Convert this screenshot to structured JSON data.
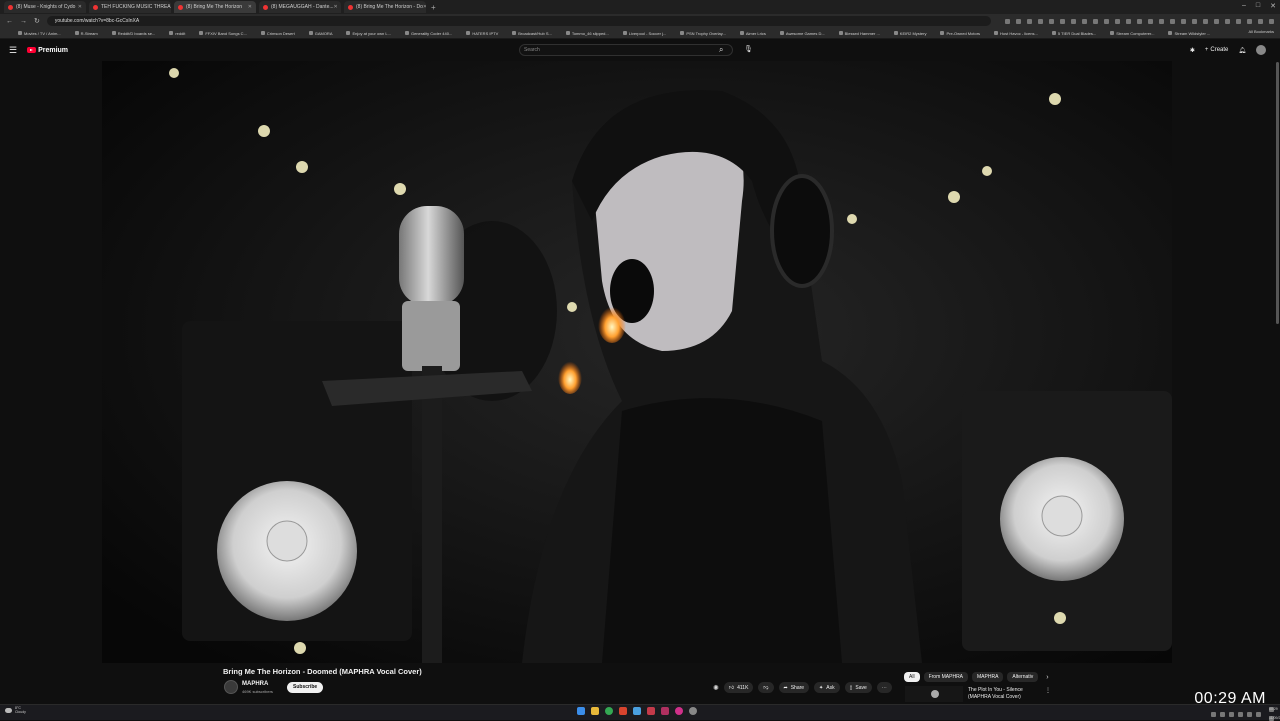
{
  "browser": {
    "tabs": [
      {
        "label": "(8) Muse - Knights of Cydo",
        "active": false
      },
      {
        "label": "TEH FUCKING MUSIC THREAD",
        "active": false
      },
      {
        "label": "(8) Bring Me The Horizon",
        "active": true
      },
      {
        "label": "(8) MEGAUGGAH - Dante...",
        "active": false
      },
      {
        "label": "(8) Bring Me The Horizon - Do",
        "active": false
      }
    ],
    "new_tab": "+",
    "url": "youtube.com/watch?v=8bc-GcCsInXA",
    "bookmarks": [
      "Movies / TV / Anim...",
      "R-Stream",
      "Reddit/D boards se...",
      "reddit",
      "FFXIV Band Songs C...",
      "Crimson Desert",
      "GAMORA",
      "Enjoy at your own L...",
      "Generality Coder 440...",
      "HATERS IPTV",
      "Broadcast/Hub S...",
      "Tommo_46 slipped...",
      "Liverpool - Soccer j...",
      "PSN Trophy Overlay...",
      "Aimer Lrics",
      "Awesome Games D...",
      "Blessed Hammer ...",
      "KEIR2 Mystery",
      "Pre-Owned Motors",
      "Host Havoc - licens...",
      "5 TIER Dual Blades...",
      "Stream Computerer...",
      "Stream Wildstyler ..."
    ],
    "all_bookmarks": "All Bookmarks"
  },
  "youtube": {
    "brand": "Premium",
    "search_placeholder": "Search",
    "create_label": "Create"
  },
  "video": {
    "title": "Bring Me The Horizon - Doomed (MAPHRA Vocal Cover)",
    "channel": "MAPHRA",
    "subscribers": "469K subscribers",
    "subscribe_label": "Subscribe",
    "likes": "411K",
    "share_label": "Share",
    "ask_label": "Ask",
    "save_label": "Save"
  },
  "related": {
    "chips": [
      "All",
      "From MAPHRA",
      "MAPHRA",
      "Alternativ"
    ],
    "next_video_title": "The Plot In You - Silence (MAPHRA Vocal Cover)"
  },
  "overlay_clock": "00:29 AM",
  "taskbar": {
    "weather_temp": "8°C",
    "weather_desc": "Cloudy",
    "time": "00:29",
    "date": "11/09/2025"
  },
  "colors": {
    "yt_red": "#ff0033",
    "bg": "#0f0f0f"
  }
}
